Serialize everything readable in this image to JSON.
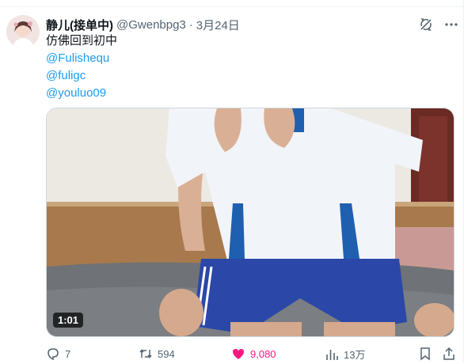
{
  "tweet": {
    "author_name": "静儿(接单中)",
    "author_handle": "@Gwenbpg3",
    "separator": "·",
    "date": "3月24日",
    "text_lines": [
      "仿佛回到初中"
    ],
    "mentions": [
      "@Fulishequ",
      "@fuligc",
      "@youluo09"
    ]
  },
  "media": {
    "duration": "1:01"
  },
  "actions": {
    "reply_count": "7",
    "retweet_count": "594",
    "like_count": "9,080",
    "view_count": "13万"
  },
  "icons": {
    "grok": "grok-icon",
    "more": "more-icon",
    "reply": "reply-icon",
    "retweet": "retweet-icon",
    "like": "heart-filled-icon",
    "views": "bar-chart-icon",
    "bookmark": "bookmark-icon",
    "share": "share-icon"
  },
  "colors": {
    "accent": "#1d9bf0",
    "like": "#f91880",
    "secondary_text": "#536471"
  }
}
